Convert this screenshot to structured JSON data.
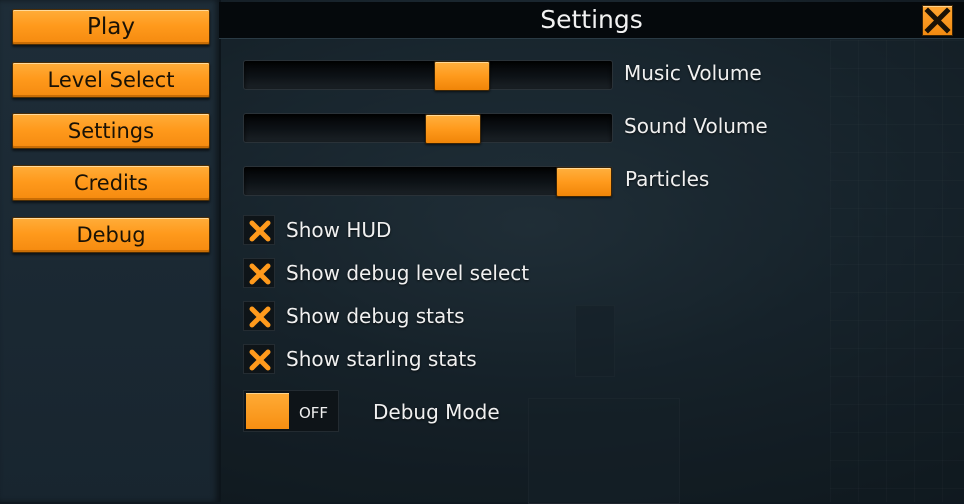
{
  "menu": {
    "items": [
      {
        "label": "Play"
      },
      {
        "label": "Level Select"
      },
      {
        "label": "Settings"
      },
      {
        "label": "Credits"
      },
      {
        "label": "Debug"
      }
    ]
  },
  "settings": {
    "title": "Settings",
    "close_icon": "x-icon",
    "sliders": [
      {
        "label": "Music Volume",
        "value": 0.61
      },
      {
        "label": "Sound Volume",
        "value": 0.58
      },
      {
        "label": "Particles",
        "value": 1.0
      }
    ],
    "checkboxes": [
      {
        "label": "Show HUD",
        "checked": true
      },
      {
        "label": "Show debug level select",
        "checked": true
      },
      {
        "label": "Show debug stats",
        "checked": true
      },
      {
        "label": "Show starling stats",
        "checked": true
      }
    ],
    "toggle": {
      "label": "Debug Mode",
      "state_text": "OFF",
      "on": false
    }
  },
  "colors": {
    "accent": "#ff9a1c",
    "panel_header": "#05090c",
    "left_panel": "#1e2d38"
  }
}
